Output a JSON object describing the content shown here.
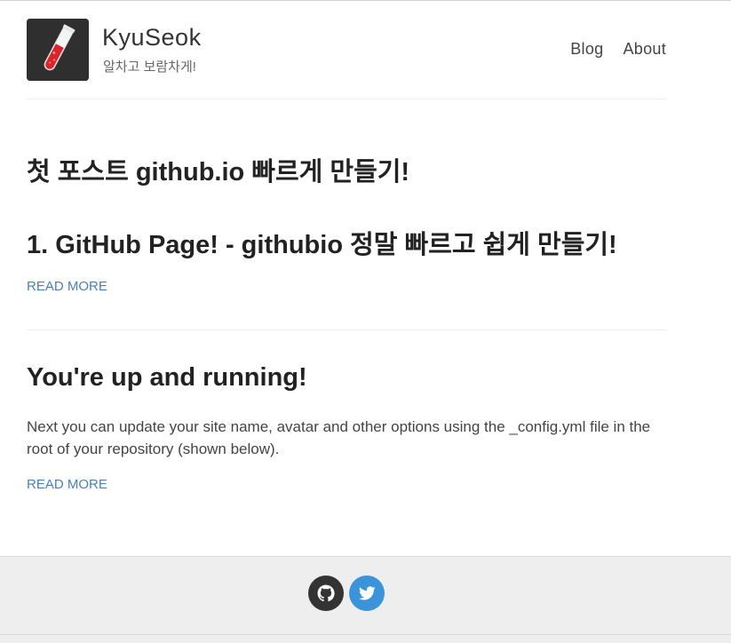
{
  "header": {
    "site_name": "KyuSeok",
    "site_description": "알차고 보람차게!",
    "avatar_icon": "test-tube-icon",
    "nav": [
      {
        "label": "Blog"
      },
      {
        "label": "About"
      }
    ]
  },
  "posts": [
    {
      "title": "첫 포스트 github.io 빠르게 만들기!",
      "subtitle": "1. GitHub Page! - githubio 정말 빠르고 쉽게 만들기!",
      "read_more": "READ MORE"
    },
    {
      "title": "You're up and running!",
      "excerpt": "Next you can update your site name, avatar and other options using the _config.yml file in the root of your repository (shown below).",
      "read_more": "READ MORE"
    }
  ],
  "footer": {
    "social": [
      {
        "icon": "github-icon",
        "color": "#333333"
      },
      {
        "icon": "twitter-icon",
        "color": "#3b94d9"
      }
    ]
  },
  "colors": {
    "link": "#4a80b8",
    "footer_bg": "#eeeeee",
    "avatar_bg": "#2f2f2f"
  }
}
